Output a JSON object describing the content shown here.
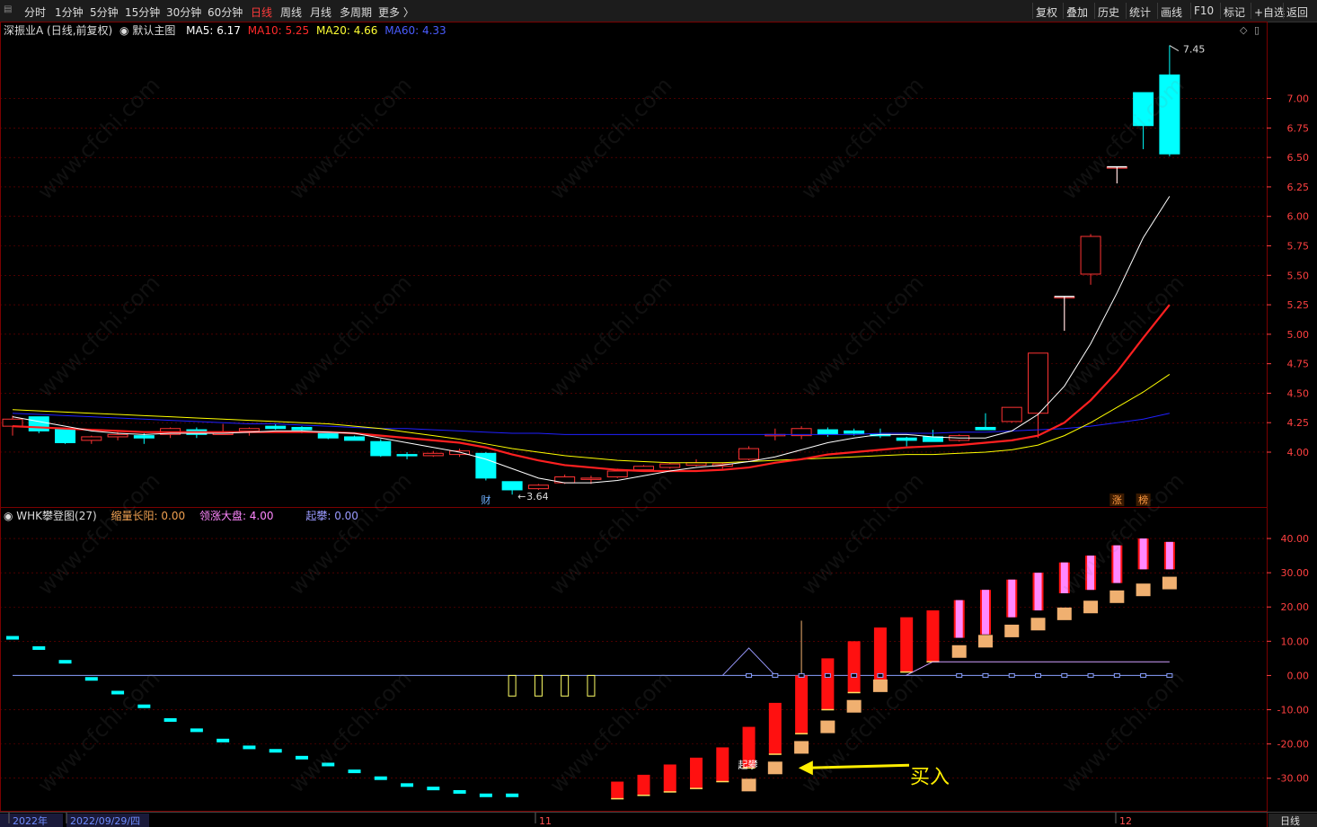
{
  "toolbar": {
    "grip": "▤",
    "left_items": [
      "分时",
      "1分钟",
      "5分钟",
      "15分钟",
      "30分钟",
      "60分钟",
      "日线",
      "周线",
      "月线",
      "多周期",
      "更多 〉"
    ],
    "active_item": "日线",
    "right_items": [
      "复权",
      "叠加",
      "历史",
      "统计",
      "画线",
      "F10",
      "标记",
      "+自选",
      "返回"
    ]
  },
  "main_header": {
    "title": "深振业A (日线,前复权)",
    "template": "默认主图",
    "ma5": "MA5: 6.17",
    "ma10": "MA10: 5.25",
    "ma20": "MA20: 4.66",
    "ma60": "MA60: 4.33"
  },
  "sub_header": {
    "title": "WHK攀登图(27)",
    "v1": "缩量长阳: 0.00",
    "v2": "领涨大盘: 4.00",
    "v3": "起攀: 0.00"
  },
  "colors": {
    "up": "#ff3333",
    "down": "#00ffff",
    "ma5": "#ffffff",
    "ma10": "#ff2020",
    "ma20": "#ffff00",
    "ma60": "#2020ff",
    "grid": "#7a0000",
    "axis_text": "#ff4040",
    "buy_arrow": "#ffee00",
    "orange_block": "#f0b070",
    "pink_bar": "#ff88ff"
  },
  "annotations": {
    "high_label": "7.45",
    "low_label": "3.64",
    "cai_label": "财",
    "zhang_label": "涨",
    "bang_label": "榜",
    "qipan_label": "起攀",
    "buy_label": "买入",
    "watermark": "www.cfchi.com"
  },
  "date_axis": {
    "items": [
      "2022年",
      "2022/09/29/四",
      "11",
      "12"
    ],
    "period": "日线"
  },
  "chart_data": [
    {
      "type": "candlestick",
      "name": "main",
      "y_ticks": [
        7.0,
        6.75,
        6.5,
        6.25,
        6.0,
        5.75,
        5.5,
        5.25,
        5.0,
        4.75,
        4.5,
        4.25,
        4.0
      ],
      "ylim": [
        3.55,
        7.5
      ],
      "candles": [
        {
          "o": 4.22,
          "h": 4.31,
          "l": 4.14,
          "c": 4.28
        },
        {
          "o": 4.3,
          "h": 4.3,
          "l": 4.16,
          "c": 4.18
        },
        {
          "o": 4.2,
          "h": 4.2,
          "l": 4.07,
          "c": 4.08
        },
        {
          "o": 4.1,
          "h": 4.14,
          "l": 4.07,
          "c": 4.13
        },
        {
          "o": 4.13,
          "h": 4.17,
          "l": 4.1,
          "c": 4.15
        },
        {
          "o": 4.14,
          "h": 4.16,
          "l": 4.07,
          "c": 4.12
        },
        {
          "o": 4.15,
          "h": 4.21,
          "l": 4.12,
          "c": 4.2
        },
        {
          "o": 4.19,
          "h": 4.21,
          "l": 4.12,
          "c": 4.15
        },
        {
          "o": 4.16,
          "h": 4.24,
          "l": 4.15,
          "c": 4.16
        },
        {
          "o": 4.18,
          "h": 4.21,
          "l": 4.14,
          "c": 4.2
        },
        {
          "o": 4.22,
          "h": 4.24,
          "l": 4.19,
          "c": 4.2
        },
        {
          "o": 4.21,
          "h": 4.22,
          "l": 4.16,
          "c": 4.19
        },
        {
          "o": 4.16,
          "h": 4.17,
          "l": 4.11,
          "c": 4.12
        },
        {
          "o": 4.13,
          "h": 4.14,
          "l": 4.1,
          "c": 4.1
        },
        {
          "o": 4.09,
          "h": 4.11,
          "l": 3.96,
          "c": 3.97
        },
        {
          "o": 3.98,
          "h": 4.0,
          "l": 3.94,
          "c": 3.97
        },
        {
          "o": 3.97,
          "h": 4.01,
          "l": 3.96,
          "c": 3.99
        },
        {
          "o": 3.98,
          "h": 4.03,
          "l": 3.96,
          "c": 4.01
        },
        {
          "o": 3.99,
          "h": 4.0,
          "l": 3.76,
          "c": 3.78
        },
        {
          "o": 3.75,
          "h": 3.75,
          "l": 3.64,
          "c": 3.68
        },
        {
          "o": 3.69,
          "h": 3.73,
          "l": 3.68,
          "c": 3.72
        },
        {
          "o": 3.74,
          "h": 3.81,
          "l": 3.73,
          "c": 3.79
        },
        {
          "o": 3.77,
          "h": 3.8,
          "l": 3.73,
          "c": 3.78
        },
        {
          "o": 3.79,
          "h": 3.86,
          "l": 3.78,
          "c": 3.84
        },
        {
          "o": 3.85,
          "h": 3.89,
          "l": 3.84,
          "c": 3.88
        },
        {
          "o": 3.87,
          "h": 3.91,
          "l": 3.86,
          "c": 3.9
        },
        {
          "o": 3.89,
          "h": 3.94,
          "l": 3.88,
          "c": 3.91
        },
        {
          "o": 3.88,
          "h": 3.91,
          "l": 3.86,
          "c": 3.9
        },
        {
          "o": 3.94,
          "h": 4.05,
          "l": 3.93,
          "c": 4.03
        },
        {
          "o": 4.14,
          "h": 4.2,
          "l": 4.1,
          "c": 4.15
        },
        {
          "o": 4.14,
          "h": 4.22,
          "l": 4.11,
          "c": 4.2
        },
        {
          "o": 4.19,
          "h": 4.21,
          "l": 4.13,
          "c": 4.15
        },
        {
          "o": 4.18,
          "h": 4.2,
          "l": 4.14,
          "c": 4.16
        },
        {
          "o": 4.15,
          "h": 4.2,
          "l": 4.12,
          "c": 4.14
        },
        {
          "o": 4.12,
          "h": 4.13,
          "l": 4.05,
          "c": 4.1
        },
        {
          "o": 4.13,
          "h": 4.19,
          "l": 4.09,
          "c": 4.09
        },
        {
          "o": 4.1,
          "h": 4.15,
          "l": 4.09,
          "c": 4.14
        },
        {
          "o": 4.21,
          "h": 4.33,
          "l": 4.19,
          "c": 4.19
        },
        {
          "o": 4.26,
          "h": 4.38,
          "l": 4.25,
          "c": 4.38
        },
        {
          "o": 4.33,
          "h": 4.84,
          "l": 4.12,
          "c": 4.84
        },
        {
          "o": 5.32,
          "h": 5.32,
          "l": 5.03,
          "c": 5.32
        },
        {
          "o": 5.51,
          "h": 5.85,
          "l": 5.42,
          "c": 5.83
        },
        {
          "o": 6.42,
          "h": 6.42,
          "l": 6.28,
          "c": 6.42
        },
        {
          "o": 7.05,
          "h": 7.05,
          "l": 6.57,
          "c": 6.77
        },
        {
          "o": 7.2,
          "h": 7.45,
          "l": 6.51,
          "c": 6.53
        }
      ],
      "ma5": [
        4.3,
        4.26,
        4.22,
        4.18,
        4.16,
        4.15,
        4.16,
        4.16,
        4.16,
        4.17,
        4.18,
        4.18,
        4.17,
        4.16,
        4.12,
        4.08,
        4.04,
        4.0,
        3.94,
        3.86,
        3.78,
        3.74,
        3.74,
        3.76,
        3.8,
        3.84,
        3.87,
        3.89,
        3.92,
        3.96,
        4.02,
        4.08,
        4.12,
        4.15,
        4.15,
        4.13,
        4.12,
        4.12,
        4.18,
        4.32,
        4.56,
        4.92,
        5.35,
        5.82,
        6.17
      ],
      "ma10": [
        4.22,
        4.21,
        4.2,
        4.19,
        4.18,
        4.17,
        4.17,
        4.17,
        4.17,
        4.17,
        4.17,
        4.17,
        4.17,
        4.16,
        4.14,
        4.12,
        4.1,
        4.08,
        4.04,
        3.98,
        3.93,
        3.89,
        3.87,
        3.85,
        3.84,
        3.84,
        3.84,
        3.85,
        3.87,
        3.91,
        3.94,
        3.98,
        4.0,
        4.02,
        4.04,
        4.05,
        4.06,
        4.08,
        4.1,
        4.14,
        4.25,
        4.44,
        4.68,
        4.97,
        5.25
      ],
      "ma20": [
        4.36,
        4.35,
        4.34,
        4.33,
        4.32,
        4.31,
        4.3,
        4.29,
        4.28,
        4.27,
        4.26,
        4.25,
        4.24,
        4.22,
        4.2,
        4.17,
        4.14,
        4.11,
        4.07,
        4.03,
        4.0,
        3.97,
        3.95,
        3.93,
        3.92,
        3.91,
        3.91,
        3.91,
        3.92,
        3.93,
        3.94,
        3.95,
        3.96,
        3.97,
        3.98,
        3.98,
        3.99,
        4.0,
        4.02,
        4.06,
        4.14,
        4.25,
        4.38,
        4.51,
        4.66
      ],
      "ma60": [
        4.33,
        4.32,
        4.31,
        4.3,
        4.29,
        4.28,
        4.27,
        4.26,
        4.25,
        4.24,
        4.24,
        4.23,
        4.22,
        4.21,
        4.2,
        4.2,
        4.19,
        4.18,
        4.17,
        4.16,
        4.16,
        4.15,
        4.15,
        4.15,
        4.15,
        4.15,
        4.15,
        4.15,
        4.15,
        4.15,
        4.15,
        4.15,
        4.15,
        4.16,
        4.16,
        4.16,
        4.17,
        4.17,
        4.18,
        4.19,
        4.2,
        4.22,
        4.25,
        4.28,
        4.33
      ]
    },
    {
      "type": "indicator",
      "name": "WHK攀登图",
      "y_ticks": [
        40,
        30,
        20,
        10,
        0,
        -10,
        -20,
        -30
      ],
      "ylim": [
        -39,
        45
      ],
      "cyan_dashes": [
        11,
        8,
        4,
        -1,
        -5,
        -9,
        -13,
        -16,
        -19,
        -21,
        -22,
        -24,
        -26,
        -28,
        -30,
        -32,
        -33,
        -34,
        -35,
        -35
      ],
      "red_bars": [
        {
          "i": 23,
          "bot": -36,
          "top": -31
        },
        {
          "i": 24,
          "bot": -35,
          "top": -29
        },
        {
          "i": 25,
          "bot": -34,
          "top": -26
        },
        {
          "i": 26,
          "bot": -33,
          "top": -24
        },
        {
          "i": 27,
          "bot": -31,
          "top": -21
        },
        {
          "i": 28,
          "bot": -27,
          "top": -15
        },
        {
          "i": 29,
          "bot": -23,
          "top": -8
        },
        {
          "i": 30,
          "bot": -17,
          "top": 0
        },
        {
          "i": 31,
          "bot": -10,
          "top": 5
        },
        {
          "i": 32,
          "bot": -5,
          "top": 10
        },
        {
          "i": 33,
          "bot": -2,
          "top": 14
        },
        {
          "i": 34,
          "bot": 1,
          "top": 17
        },
        {
          "i": 35,
          "bot": 4,
          "top": 19
        }
      ],
      "pink_bars": [
        {
          "i": 36,
          "bot": 11,
          "top": 22
        },
        {
          "i": 37,
          "bot": 12,
          "top": 25
        },
        {
          "i": 38,
          "bot": 17,
          "top": 28
        },
        {
          "i": 39,
          "bot": 19,
          "top": 30
        },
        {
          "i": 40,
          "bot": 24,
          "top": 33
        },
        {
          "i": 41,
          "bot": 25,
          "top": 35
        },
        {
          "i": 42,
          "bot": 27,
          "top": 38
        },
        {
          "i": 43,
          "bot": 31,
          "top": 40
        },
        {
          "i": 44,
          "bot": 31,
          "top": 39
        }
      ],
      "orange_blocks": [
        {
          "i": 28,
          "v": -32
        },
        {
          "i": 29,
          "v": -27
        },
        {
          "i": 30,
          "v": -21
        },
        {
          "i": 31,
          "v": -15
        },
        {
          "i": 32,
          "v": -9
        },
        {
          "i": 33,
          "v": -3
        },
        {
          "i": 36,
          "v": 7
        },
        {
          "i": 37,
          "v": 10
        },
        {
          "i": 38,
          "v": 13
        },
        {
          "i": 39,
          "v": 15
        },
        {
          "i": 40,
          "v": 18
        },
        {
          "i": 41,
          "v": 20
        },
        {
          "i": 42,
          "v": 23
        },
        {
          "i": 43,
          "v": 25
        },
        {
          "i": 44,
          "v": 27
        }
      ],
      "yellow_boxes": [
        19,
        20,
        21,
        22
      ],
      "zero_squares": [
        28,
        29,
        30,
        31,
        32,
        33,
        36,
        37,
        38,
        39,
        40,
        41,
        42,
        43,
        44
      ],
      "tall_spike": {
        "i": 30,
        "v": 16
      },
      "triangle": {
        "from": 27,
        "peak": 28,
        "to": 29,
        "v": 8
      },
      "lavender_line": {
        "from": 35,
        "to": 44,
        "v": 4
      }
    }
  ]
}
